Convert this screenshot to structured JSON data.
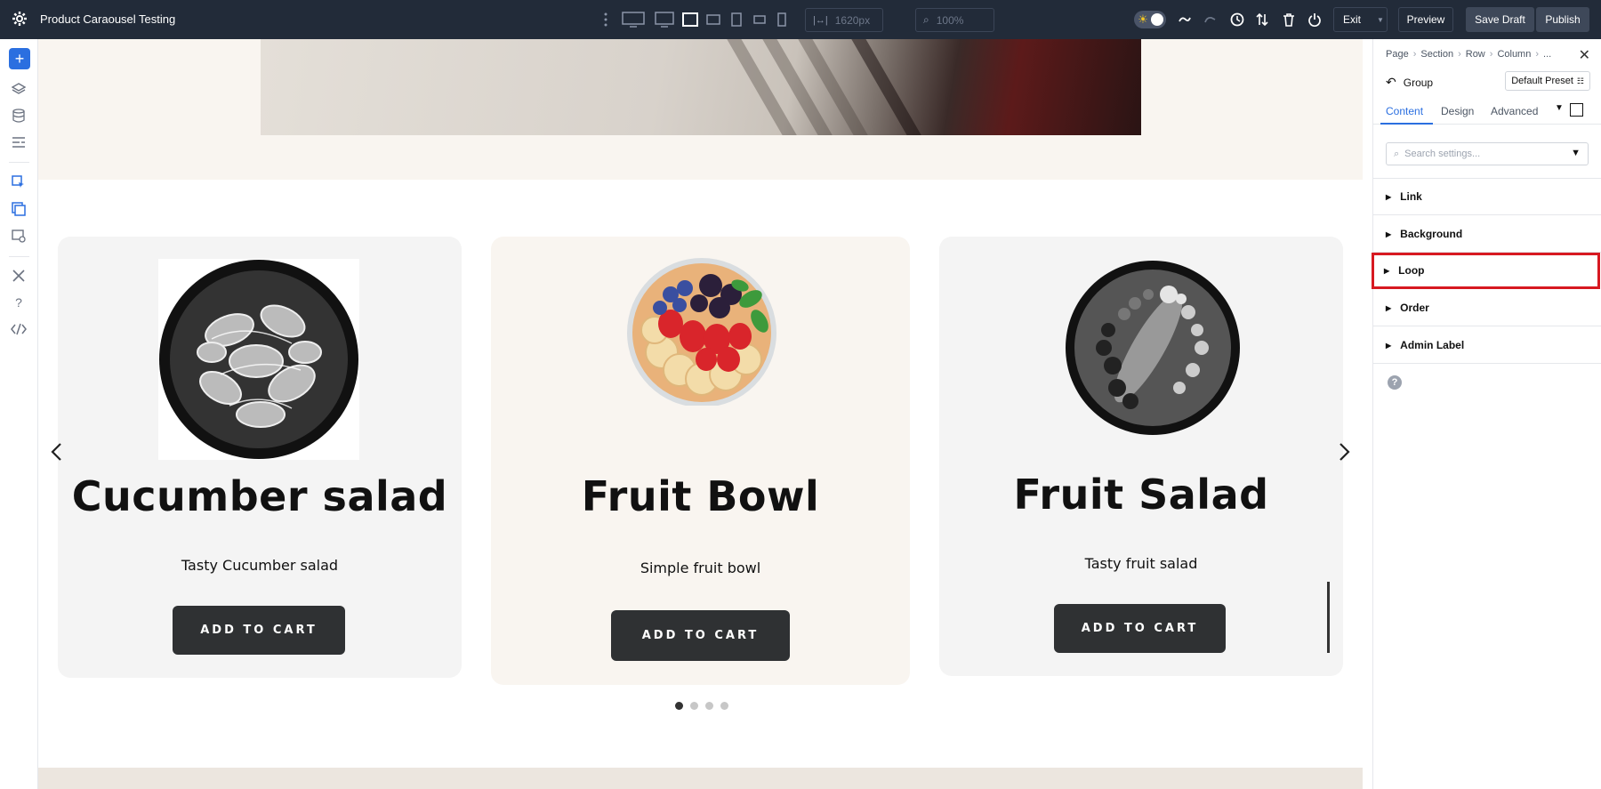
{
  "topbar": {
    "title": "Product Caraousel Testing",
    "width_field": "1620px",
    "zoom_field": "100%",
    "exit_label": "Exit",
    "preview_label": "Preview",
    "save_draft_label": "Save Draft",
    "publish_label": "Publish"
  },
  "carousel": {
    "cards": [
      {
        "name": "Cucumber salad",
        "desc": "Tasty Cucumber salad",
        "button": "ADD TO CART",
        "photo": "cucumber-salad-photo"
      },
      {
        "name": "Fruit Bowl",
        "desc": "Simple fruit bowl",
        "button": "ADD TO CART",
        "photo": "fruit-bowl-photo"
      },
      {
        "name": "Fruit Salad",
        "desc": "Tasty fruit salad",
        "button": "ADD TO CART",
        "photo": "fruit-salad-photo"
      }
    ],
    "dots_total": 4,
    "active_dot": 1
  },
  "panel": {
    "breadcrumb": [
      "Page",
      "Section",
      "Row",
      "Column",
      "..."
    ],
    "group_label": "Group",
    "preset_label": "Default Preset",
    "tabs": [
      "Content",
      "Design",
      "Advanced"
    ],
    "active_tab": "Content",
    "search_placeholder": "Search settings...",
    "sections": [
      "Link",
      "Background",
      "Loop",
      "Order",
      "Admin Label"
    ],
    "highlighted_section": "Loop"
  },
  "colors": {
    "topbar_bg": "#222b39",
    "accent": "#2b6fe0",
    "highlight": "#d71921",
    "button_dark": "#2f3133",
    "card_gray": "#f4f4f4",
    "card_cream": "#f9f5f0"
  }
}
